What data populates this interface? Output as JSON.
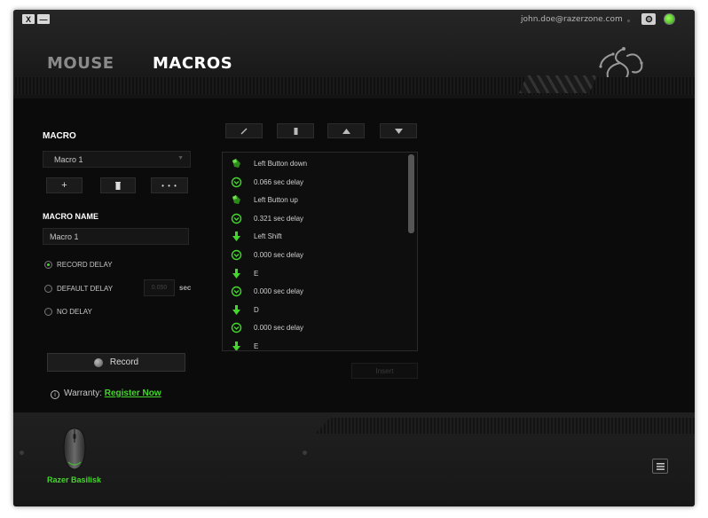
{
  "window_controls": {
    "close": "X",
    "minimize": "—"
  },
  "header": {
    "user_email": "john.doe@razerzone.com",
    "tabs": [
      {
        "label": "MOUSE"
      },
      {
        "label": "MACROS"
      }
    ]
  },
  "macro_panel": {
    "section_label": "MACRO",
    "selected_macro": "Macro 1",
    "add_label": "+",
    "more_label": "• • •",
    "name_label": "MACRO NAME",
    "name_value": "Macro 1",
    "options": [
      {
        "label": "RECORD DELAY",
        "selected": true
      },
      {
        "label": "DEFAULT DELAY",
        "selected": false
      },
      {
        "label": "NO DELAY",
        "selected": false
      }
    ],
    "default_delay_value": "0.050",
    "delay_unit": "sec",
    "record_label": "Record",
    "warranty_label": "Warranty:",
    "warranty_link": "Register Now"
  },
  "events": [
    {
      "icon": "mouse-icon",
      "text": "Left Button down"
    },
    {
      "icon": "clock-icon",
      "text": "0.066 sec delay"
    },
    {
      "icon": "mouse-icon",
      "text": "Left Button up"
    },
    {
      "icon": "clock-icon",
      "text": "0.321 sec delay"
    },
    {
      "icon": "key-down-arrow-icon",
      "text": "Left Shift"
    },
    {
      "icon": "clock-icon",
      "text": "0.000 sec delay"
    },
    {
      "icon": "key-down-arrow-icon",
      "text": "E"
    },
    {
      "icon": "clock-icon",
      "text": "0.000 sec delay"
    },
    {
      "icon": "key-down-arrow-icon",
      "text": "D"
    },
    {
      "icon": "clock-icon",
      "text": "0.000 sec delay"
    },
    {
      "icon": "key-down-arrow-icon",
      "text": "E"
    }
  ],
  "list_actions": {
    "insert_label": "Insert"
  },
  "footer": {
    "device_name": "Razer Basilisk"
  },
  "colors": {
    "accent": "#44d62c",
    "background": "#0b0b0b"
  }
}
